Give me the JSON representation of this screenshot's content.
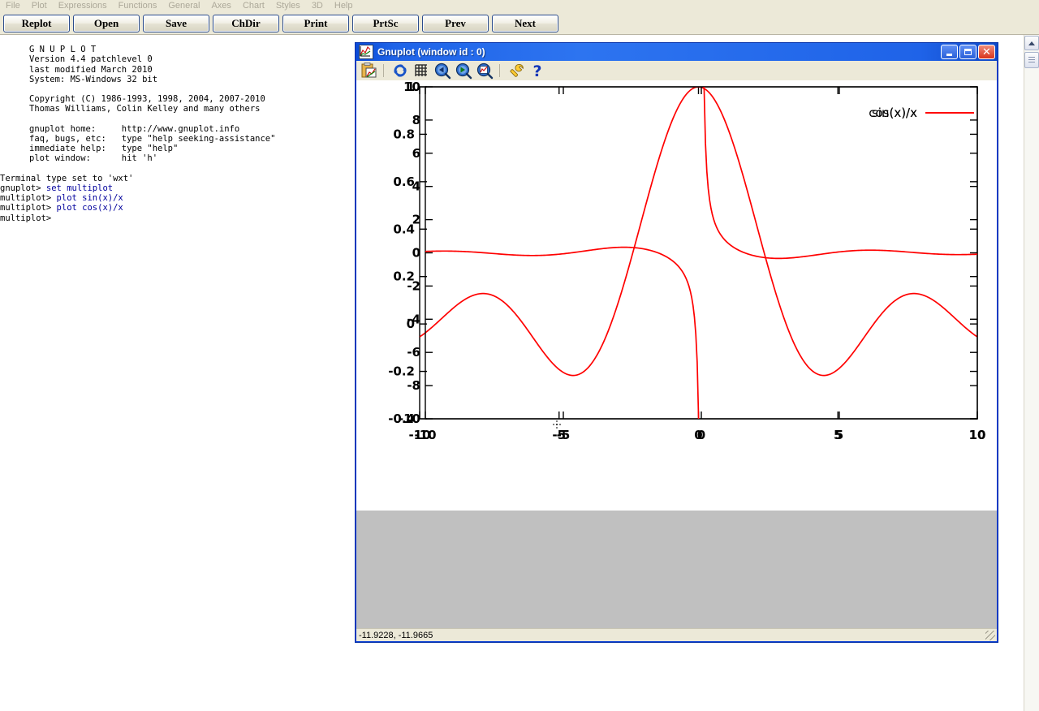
{
  "menubar": {
    "items": [
      {
        "label": "File"
      },
      {
        "label": "Plot"
      },
      {
        "label": "Expressions"
      },
      {
        "label": "Functions"
      },
      {
        "label": "General"
      },
      {
        "label": "Axes"
      },
      {
        "label": "Chart"
      },
      {
        "label": "Styles"
      },
      {
        "label": "3D"
      },
      {
        "label": "Help"
      }
    ]
  },
  "toolbar": {
    "buttons": [
      {
        "label": "Replot",
        "name": "replot-button"
      },
      {
        "label": "Open",
        "name": "open-button"
      },
      {
        "label": "Save",
        "name": "save-button"
      },
      {
        "label": "ChDir",
        "name": "chdir-button"
      },
      {
        "label": "Print",
        "name": "print-button"
      },
      {
        "label": "PrtSc",
        "name": "prtsc-button"
      },
      {
        "label": "Prev",
        "name": "prev-button"
      },
      {
        "label": "Next",
        "name": "next-button"
      }
    ]
  },
  "console": {
    "banner_lines": [
      "G N U P L O T",
      "Version 4.4 patchlevel 0",
      "last modified March 2010",
      "System: MS-Windows 32 bit",
      "",
      "Copyright (C) 1986-1993, 1998, 2004, 2007-2010",
      "Thomas Williams, Colin Kelley and many others",
      "",
      "gnuplot home:     http://www.gnuplot.info",
      "faq, bugs, etc:   type \"help seeking-assistance\"",
      "immediate help:   type \"help\"",
      "plot window:      hit 'h'"
    ],
    "terminal_line": "Terminal type set to 'wxt'",
    "session": [
      {
        "prompt": "gnuplot> ",
        "command": "set multiplot"
      },
      {
        "prompt": "multiplot> ",
        "command": "plot sin(x)/x"
      },
      {
        "prompt": "multiplot> ",
        "command": "plot cos(x)/x"
      },
      {
        "prompt": "multiplot> ",
        "command": ""
      }
    ]
  },
  "plot_window": {
    "title": "Gnuplot (window id : 0)",
    "window_buttons": {
      "minimize": "_",
      "maximize": "□",
      "close": "✕"
    },
    "toolbar_icons": [
      {
        "name": "copy-to-clipboard-icon"
      },
      {
        "name": "replot-icon"
      },
      {
        "name": "grid-icon"
      },
      {
        "name": "zoom-previous-icon"
      },
      {
        "name": "zoom-next-icon"
      },
      {
        "name": "autoscale-icon"
      },
      {
        "name": "options-wrench-icon"
      },
      {
        "name": "help-icon"
      }
    ],
    "statusbar": {
      "coordinates": "-11.9228, -11.9665"
    }
  },
  "chart_data": {
    "type": "line",
    "title": "",
    "xlabel": "",
    "ylabel": "",
    "multiplot": true,
    "grid": false,
    "legend_position": "top-right",
    "overlaid_plots": [
      {
        "expression": "sin(x)/x",
        "legend": "sin(x)/x",
        "color": "#ff0000",
        "xlim": [
          -10,
          10
        ],
        "ylim": [
          -0.4,
          1.0
        ],
        "xticks": [
          -10,
          -5,
          0,
          5,
          10
        ],
        "yticks": [
          -0.4,
          -0.2,
          0,
          0.2,
          0.4,
          0.6,
          0.8,
          1.0
        ],
        "ytick_labels": [
          "-0.4",
          "-0.2",
          "0",
          "0.2",
          "0.4",
          "0.6",
          "0.8",
          "1"
        ],
        "xtick_labels": [
          "-10",
          "-5",
          "0",
          "5",
          "10"
        ],
        "samples": 400
      },
      {
        "expression": "cos(x)/x",
        "legend": "cos(x)/x",
        "color": "#ff0000",
        "xlim": [
          -10,
          10
        ],
        "ylim": [
          -10,
          10
        ],
        "xticks": [
          -10,
          -5,
          0,
          5,
          10
        ],
        "yticks": [
          -10,
          -8,
          -6,
          -4,
          -2,
          0,
          2,
          4,
          6,
          8,
          10
        ],
        "ytick_labels": [
          "-10",
          "-8",
          "-6",
          "-4",
          "-2",
          "0",
          "2",
          "4",
          "6",
          "8",
          "10"
        ],
        "xtick_labels": [
          "-10",
          "-5",
          "0",
          "5",
          "10"
        ],
        "samples": 400
      }
    ]
  }
}
